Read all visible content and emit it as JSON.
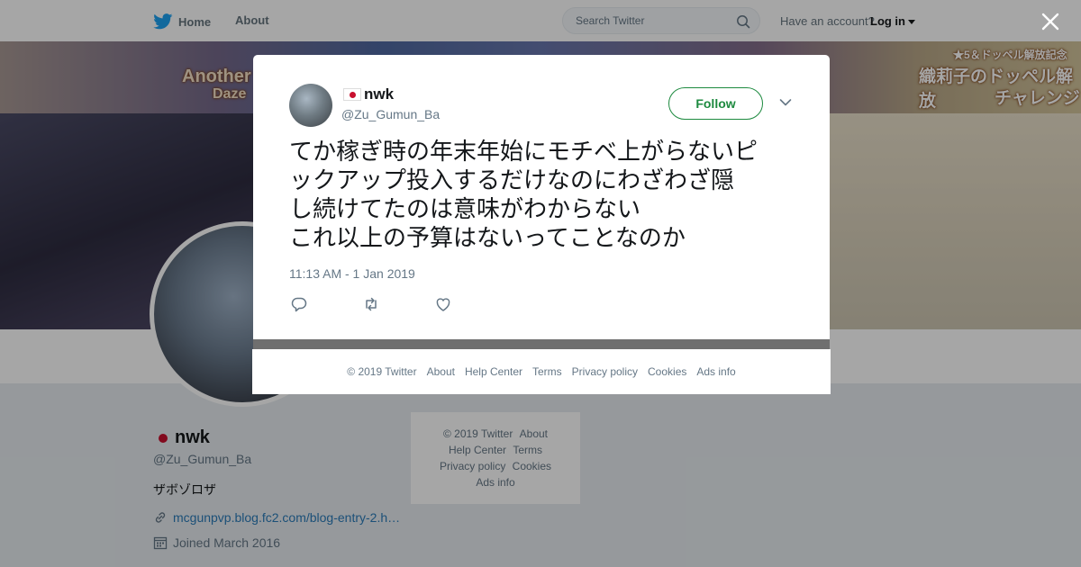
{
  "nav": {
    "home_label": "Home",
    "about_label": "About",
    "search_placeholder": "Search Twitter",
    "account_prompt": "Have an account?",
    "login_label": "Log in"
  },
  "banner": {
    "left_title": "Another",
    "left_sub": "Daze",
    "right_badge": "★5＆ドッペル解放記念",
    "right_title": "織莉子のドッペル解放",
    "right_sub": "チャレンジ"
  },
  "profile": {
    "name": "nwk",
    "handle": "@Zu_Gumun_Ba",
    "bio": "ザボゾロザ",
    "link": "mcgunpvp.blog.fc2.com/blog-entry-2.h…",
    "joined": "Joined March 2016"
  },
  "page_footer": {
    "line1": [
      "© 2019 Twitter",
      "About"
    ],
    "line2": [
      "Help Center",
      "Terms"
    ],
    "line3": [
      "Privacy policy",
      "Cookies"
    ],
    "line4": [
      "Ads info"
    ]
  },
  "tweet": {
    "name": "nwk",
    "handle": "@Zu_Gumun_Ba",
    "follow_label": "Follow",
    "lines": [
      "てか稼ぎ時の年末年始にモチベ上がらないピ",
      "ックアップ投入するだけなのにわざわざ隠",
      "し続けてたのは意味がわからない",
      "これ以上の予算はないってことなのか"
    ],
    "timestamp": "11:13 AM - 1 Jan 2019"
  },
  "modal_footer": [
    "© 2019 Twitter",
    "About",
    "Help Center",
    "Terms",
    "Privacy policy",
    "Cookies",
    "Ads info"
  ],
  "colors": {
    "accent_green": "#1d8a3f",
    "link_blue": "#2b7bb9",
    "twitter_blue": "#1da1f2",
    "flag_red": "#c8102e"
  },
  "icons": [
    "twitter-bird-icon",
    "search-icon",
    "close-icon",
    "chevron-down-icon",
    "reply-icon",
    "retweet-icon",
    "like-icon",
    "link-icon",
    "calendar-icon"
  ]
}
